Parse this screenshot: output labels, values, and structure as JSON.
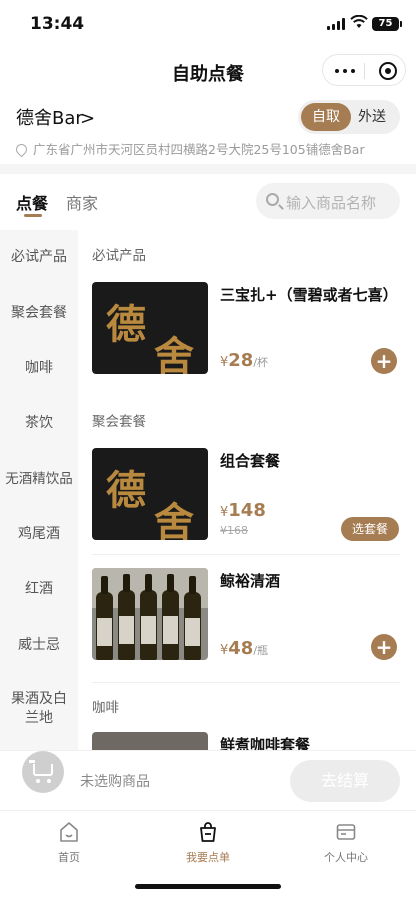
{
  "status": {
    "time": "13:44",
    "battery": "75"
  },
  "nav": {
    "title": "自助点餐"
  },
  "store": {
    "name": "德舍Bar",
    "arrow": ">",
    "mode_active": "自取",
    "mode_inactive": "外送",
    "address": "广东省广州市天河区员村四横路2号大院25号105铺德舍Bar"
  },
  "tabs": {
    "order": "点餐",
    "merchant": "商家"
  },
  "search": {
    "placeholder": "输入商品名称"
  },
  "categories": [
    "必试产品",
    "聚会套餐",
    "咖啡",
    "茶饮",
    "无酒精饮品",
    "鸡尾酒",
    "红酒",
    "威士忌",
    "果酒及白兰地"
  ],
  "sections": [
    {
      "title": "必试产品"
    },
    {
      "title": "聚会套餐"
    },
    {
      "title": "咖啡"
    }
  ],
  "products": [
    {
      "name": "三宝扎+（雪碧或者七喜）",
      "currency": "¥",
      "price": "28",
      "unit": "/杯",
      "logo": [
        "德",
        "舍"
      ]
    },
    {
      "name": "组合套餐",
      "currency": "¥",
      "price": "148",
      "old_price": "¥168",
      "button": "选套餐",
      "logo": [
        "德",
        "舍"
      ]
    },
    {
      "name": "鲸裕清酒",
      "currency": "¥",
      "price": "48",
      "unit": "/瓶"
    },
    {
      "name": "鲜煮咖啡套餐"
    }
  ],
  "cart": {
    "empty_text": "未选购商品",
    "checkout": "去结算"
  },
  "tabbar": [
    {
      "label": "首页"
    },
    {
      "label": "我要点单"
    },
    {
      "label": "个人中心"
    }
  ],
  "colors": {
    "accent": "#a67c52",
    "logo_gold": "#b8893e"
  }
}
